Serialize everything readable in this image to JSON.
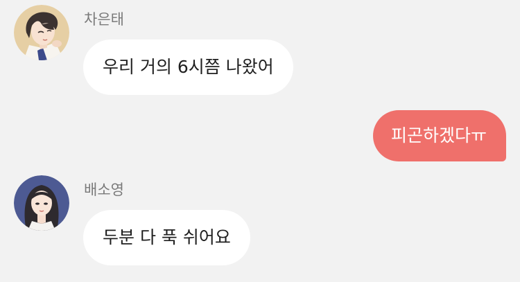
{
  "conversation": {
    "messages": [
      {
        "sender": "차은태",
        "text": "우리 거의 6시쯤 나왔어"
      },
      {
        "text": "피곤하겠다ㅠ"
      },
      {
        "sender": "배소영",
        "text": "두분 다 푹 쉬어요"
      }
    ]
  },
  "icons": {
    "avatar_1": "male-avatar-icon",
    "avatar_2": "female-avatar-icon"
  },
  "colors": {
    "background": "#f2f2f2",
    "incoming_bubble": "#ffffff",
    "outgoing_bubble": "#ef706b",
    "sender_name": "#7a7a7a",
    "message_text": "#1f1f1f"
  }
}
